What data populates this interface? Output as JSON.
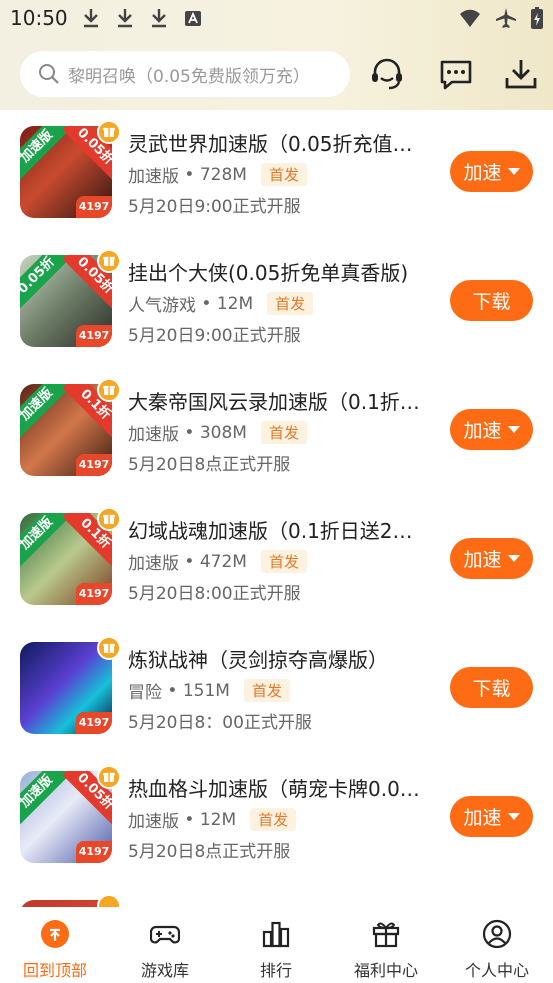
{
  "status": {
    "time": "10:50"
  },
  "search": {
    "placeholder": "黎明召唤（0.05免费版领万充）"
  },
  "icons": {
    "search": "search-icon",
    "service": "headset-icon",
    "message": "message-icon",
    "download": "download-icon",
    "gift": "gift-icon",
    "home_top": "back-to-top-icon",
    "game_library": "gamepad-icon",
    "ranking": "ranking-icon",
    "welfare": "gift-box-icon",
    "profile": "user-icon"
  },
  "colors": {
    "accent": "#fd6c14",
    "badge_text": "#e57a2a",
    "badge_bg": "#fdf1e0"
  },
  "games": [
    {
      "title": "灵武世界加速版（0.05折充值…",
      "category": "加速版",
      "size": "728M",
      "badge": "首发",
      "schedule": "5月20日9:00正式开服",
      "button": "加速",
      "dropdown": true,
      "ribbon_left": "加速版",
      "ribbon_right": "0.05折",
      "thumb": "4197"
    },
    {
      "title": "挂出个大侠(0.05折免单真香版)",
      "category": "人气游戏",
      "size": "12M",
      "badge": "首发",
      "schedule": "5月20日9:00正式开服",
      "button": "下载",
      "dropdown": false,
      "ribbon_left": "0.05折",
      "ribbon_right": "0.05折",
      "thumb": "4197"
    },
    {
      "title": "大秦帝国风云录加速版（0.1折…",
      "category": "加速版",
      "size": "308M",
      "badge": "首发",
      "schedule": "5月20日8点正式开服",
      "button": "加速",
      "dropdown": true,
      "ribbon_left": "加速版",
      "ribbon_right": "0.1折",
      "thumb": "4197"
    },
    {
      "title": "幻域战魂加速版（0.1折日送2…",
      "category": "加速版",
      "size": "472M",
      "badge": "首发",
      "schedule": "5月20日8:00正式开服",
      "button": "加速",
      "dropdown": true,
      "ribbon_left": "加速版",
      "ribbon_right": "0.1折",
      "thumb": "4197"
    },
    {
      "title": "炼狱战神（灵剑掠夺高爆版）",
      "category": "冒险",
      "size": "151M",
      "badge": "首发",
      "schedule": "5月20日8：00正式开服",
      "button": "下载",
      "dropdown": false,
      "ribbon_left": "",
      "ribbon_right": "",
      "thumb": "4197"
    },
    {
      "title": "热血格斗加速版（萌宠卡牌0.0…",
      "category": "加速版",
      "size": "12M",
      "badge": "首发",
      "schedule": "5月20日8点正式开服",
      "button": "加速",
      "dropdown": true,
      "ribbon_left": "加速版",
      "ribbon_right": "0.05折",
      "thumb": "4197"
    }
  ],
  "tabs": [
    {
      "label": "回到顶部",
      "active": true
    },
    {
      "label": "游戏库",
      "active": false
    },
    {
      "label": "排行",
      "active": false
    },
    {
      "label": "福利中心",
      "active": false
    },
    {
      "label": "个人中心",
      "active": false
    }
  ]
}
